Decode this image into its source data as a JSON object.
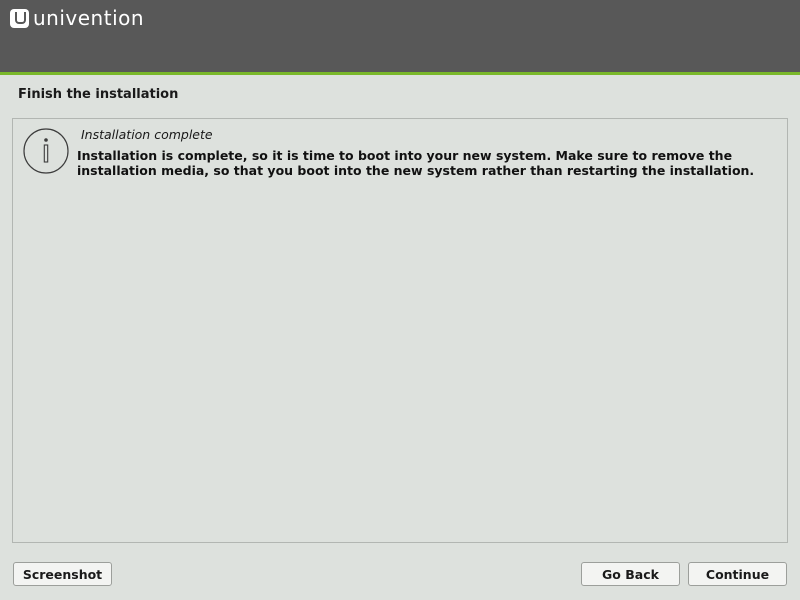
{
  "brand": {
    "name": "univention",
    "icon": "univention-logo-icon",
    "header_color": "#585858",
    "accent_color": "#7ab82a"
  },
  "page": {
    "title": "Finish the installation"
  },
  "message": {
    "icon": "info-icon",
    "title": "Installation complete",
    "body": "Installation is complete, so it is time to boot into your new system. Make sure to remove the installation media, so that you boot into the new system rather than restarting the installation."
  },
  "buttons": {
    "screenshot": "Screenshot",
    "go_back": "Go Back",
    "continue": "Continue"
  }
}
